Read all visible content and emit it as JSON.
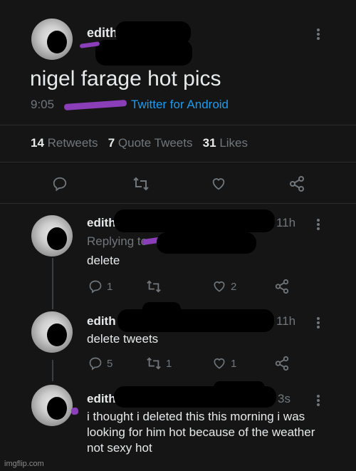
{
  "main_tweet": {
    "author_name": "edith",
    "text": "nigel farage hot pics",
    "time": "9:05",
    "client": "Twitter for Android",
    "stats": {
      "retweets_count": "14",
      "retweets_label": "Retweets",
      "quotes_count": "7",
      "quotes_label": "Quote Tweets",
      "likes_count": "31",
      "likes_label": "Likes"
    }
  },
  "replies": [
    {
      "author_name": "edith",
      "time": "11h",
      "replying_to": "Replying to",
      "text": "delete",
      "reply_count": "1",
      "retweet_count": "",
      "like_count": "2"
    },
    {
      "author_name": "edith",
      "time": "11h",
      "text": "delete tweets",
      "reply_count": "5",
      "retweet_count": "1",
      "like_count": "1"
    },
    {
      "author_name": "edith",
      "time": "3s",
      "text": "i thought i deleted this this morning i was looking for him hot because of the weather not sexy hot"
    }
  ],
  "watermark": "imgflip.com",
  "icons": {
    "reply": "reply-icon",
    "retweet": "retweet-icon",
    "like": "heart-icon",
    "share": "share-icon",
    "more": "more-vertical-icon"
  },
  "colors": {
    "background": "#151515",
    "text": "#e7e9ea",
    "muted": "#71767b",
    "link": "#1d9bf0",
    "scribble": "#8a3fb8"
  }
}
